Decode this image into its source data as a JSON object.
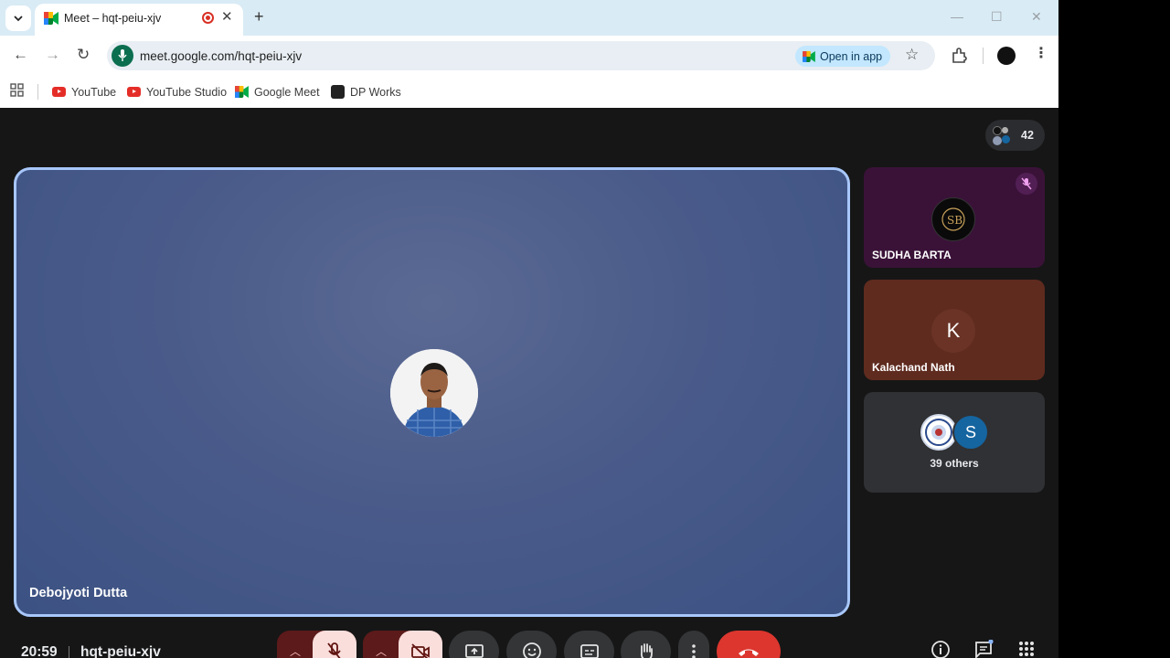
{
  "browser": {
    "tab_title": "Meet – hqt-peiu-xjv",
    "url": "meet.google.com/hqt-peiu-xjv",
    "open_in_app": "Open in app",
    "bookmarks": [
      "YouTube",
      "YouTube Studio",
      "Google Meet",
      "DP Works"
    ]
  },
  "meet": {
    "participant_count": "42",
    "main_speaker": "Debojyoti Dutta",
    "tiles": [
      {
        "name": "SUDHA BARTA",
        "muted": true
      },
      {
        "name": "Kalachand Nath",
        "initial": "K"
      },
      {
        "name": "39 others",
        "initial": "S"
      }
    ],
    "time": "20:59",
    "meeting_code": "hqt-peiu-xjv"
  },
  "colors": {
    "tab_strip": "#d9ebf5",
    "main_tile": "#46588a",
    "active_border": "#a8c7fa",
    "tile_sudha": "#3a1238",
    "tile_kalachand": "#5f2b1f",
    "tile_others": "#303134",
    "end_call": "#dc362e",
    "muted_control": "#f9dedc"
  },
  "icons": [
    "mic-off-icon",
    "video-off-icon",
    "present-icon",
    "emoji-icon",
    "captions-icon",
    "raise-hand-icon",
    "more-icon",
    "end-call-icon",
    "info-icon",
    "chat-icon",
    "activities-icon"
  ]
}
